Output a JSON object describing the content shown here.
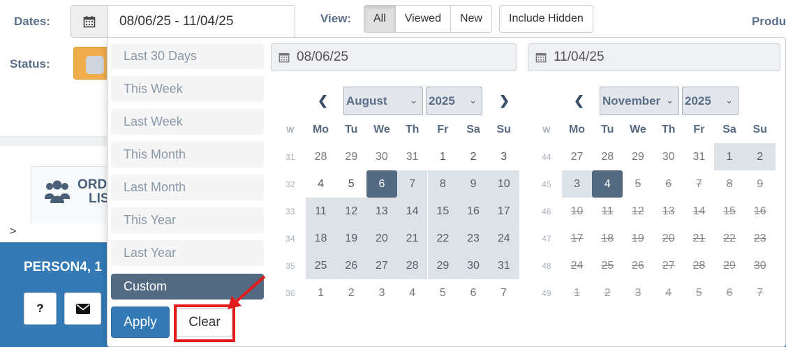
{
  "filters": {
    "dates_label": "Dates:",
    "dates_value": "08/06/25 - 11/04/25",
    "view_label": "View:",
    "view_buttons": [
      "All",
      "Viewed",
      "New"
    ],
    "view_active": "All",
    "include_hidden_label": "Include Hidden",
    "status_label": "Status:",
    "status_color": "#f0ad4e",
    "products_label": "Produ"
  },
  "page": {
    "order_list_line1": "ORD",
    "order_list_line2": "LIS",
    "breadcrumb_arrow": ">",
    "person_label": "PERSON4, 1",
    "help_button": "?",
    "mail_icon": "envelope-icon",
    "band_color": "#337ab7"
  },
  "daterange": {
    "ranges": [
      "Last 30 Days",
      "This Week",
      "Last Week",
      "This Month",
      "Last Month",
      "This Year",
      "Last Year",
      "Custom"
    ],
    "active_range": "Custom",
    "apply_label": "Apply",
    "clear_label": "Clear",
    "highlight_color": "#e21b1b",
    "start_input": "08/06/25",
    "end_input": "11/04/25",
    "weekday_header": [
      "W",
      "Mo",
      "Tu",
      "We",
      "Th",
      "Fr",
      "Sa",
      "Su"
    ],
    "left_calendar": {
      "month": "August",
      "year": "2025",
      "weeks": [
        {
          "w": "31",
          "days": [
            "28",
            "29",
            "30",
            "31",
            "1",
            "2",
            "3"
          ]
        },
        {
          "w": "32",
          "days": [
            "4",
            "5",
            "6",
            "7",
            "8",
            "9",
            "10"
          ]
        },
        {
          "w": "33",
          "days": [
            "11",
            "12",
            "13",
            "14",
            "15",
            "16",
            "17"
          ]
        },
        {
          "w": "34",
          "days": [
            "18",
            "19",
            "20",
            "21",
            "22",
            "23",
            "24"
          ]
        },
        {
          "w": "35",
          "days": [
            "25",
            "26",
            "27",
            "28",
            "29",
            "30",
            "31"
          ]
        },
        {
          "w": "36",
          "days": [
            "1",
            "2",
            "3",
            "4",
            "5",
            "6",
            "7"
          ]
        }
      ]
    },
    "right_calendar": {
      "month": "November",
      "year": "2025",
      "weeks": [
        {
          "w": "44",
          "days": [
            "27",
            "28",
            "29",
            "30",
            "31",
            "1",
            "2"
          ]
        },
        {
          "w": "45",
          "days": [
            "3",
            "4",
            "5",
            "6",
            "7",
            "8",
            "9"
          ]
        },
        {
          "w": "46",
          "days": [
            "10",
            "11",
            "12",
            "13",
            "14",
            "15",
            "16"
          ]
        },
        {
          "w": "47",
          "days": [
            "17",
            "18",
            "19",
            "20",
            "21",
            "22",
            "23"
          ]
        },
        {
          "w": "48",
          "days": [
            "24",
            "25",
            "26",
            "27",
            "28",
            "29",
            "30"
          ]
        },
        {
          "w": "49",
          "days": [
            "1",
            "2",
            "3",
            "4",
            "5",
            "6",
            "7"
          ]
        }
      ]
    }
  }
}
